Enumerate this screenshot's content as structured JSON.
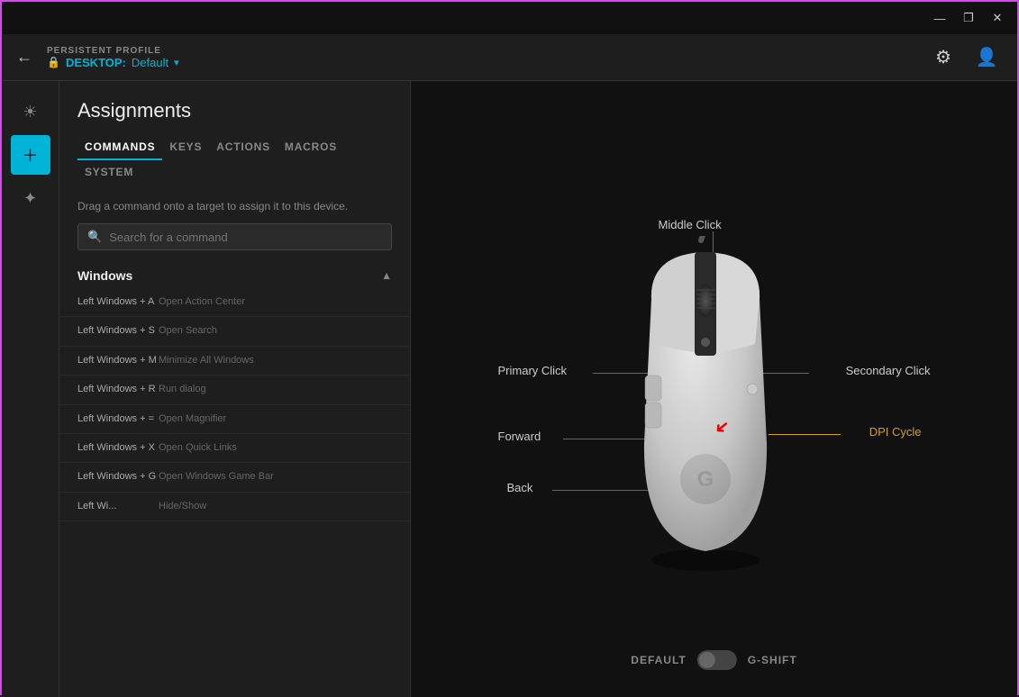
{
  "titlebar": {
    "minimize_label": "—",
    "maximize_label": "❐",
    "close_label": "✕"
  },
  "header": {
    "back_icon": "←",
    "persistent_label": "PERSISTENT PROFILE",
    "lock_icon": "🔒",
    "desktop_label": "DESKTOP:",
    "default_label": "Default",
    "chevron": "▾",
    "settings_icon": "⚙",
    "user_icon": "👤"
  },
  "sidebar": {
    "items": [
      {
        "icon": "☀",
        "name": "lighting",
        "active": false
      },
      {
        "icon": "+",
        "name": "assignments",
        "active": true
      },
      {
        "icon": "✦",
        "name": "other",
        "active": false
      }
    ]
  },
  "panel": {
    "title": "Assignments",
    "tabs": [
      {
        "label": "COMMANDS",
        "active": true
      },
      {
        "label": "KEYS",
        "active": false
      },
      {
        "label": "ACTIONS",
        "active": false
      },
      {
        "label": "MACROS",
        "active": false
      },
      {
        "label": "SYSTEM",
        "active": false
      }
    ],
    "drag_hint": "Drag a command onto a target to assign it to this device.",
    "search_placeholder": "Search for a command",
    "section_label": "Windows",
    "section_chevron": "▲",
    "commands": [
      {
        "key": "Left Windows + A",
        "desc": "Open Action Center"
      },
      {
        "key": "Left Windows + S",
        "desc": "Open Search"
      },
      {
        "key": "Left Windows + M",
        "desc": "Minimize All Windows"
      },
      {
        "key": "Left Windows + R",
        "desc": "Run dialog"
      },
      {
        "key": "Left Windows + =",
        "desc": "Open Magnifier"
      },
      {
        "key": "Left Windows + X",
        "desc": "Open Quick Links"
      },
      {
        "key": "Left Windows + G",
        "desc": "Open Windows Game Bar"
      },
      {
        "key": "Left Wi...",
        "desc": "Hide/Show"
      }
    ]
  },
  "mouse": {
    "labels": {
      "middle_click": "Middle Click",
      "primary_click": "Primary Click",
      "secondary_click": "Secondary Click",
      "forward": "Forward",
      "dpi_cycle": "DPI Cycle",
      "back": "Back"
    },
    "toggle": {
      "left_label": "DEFAULT",
      "right_label": "G-SHIFT"
    }
  }
}
